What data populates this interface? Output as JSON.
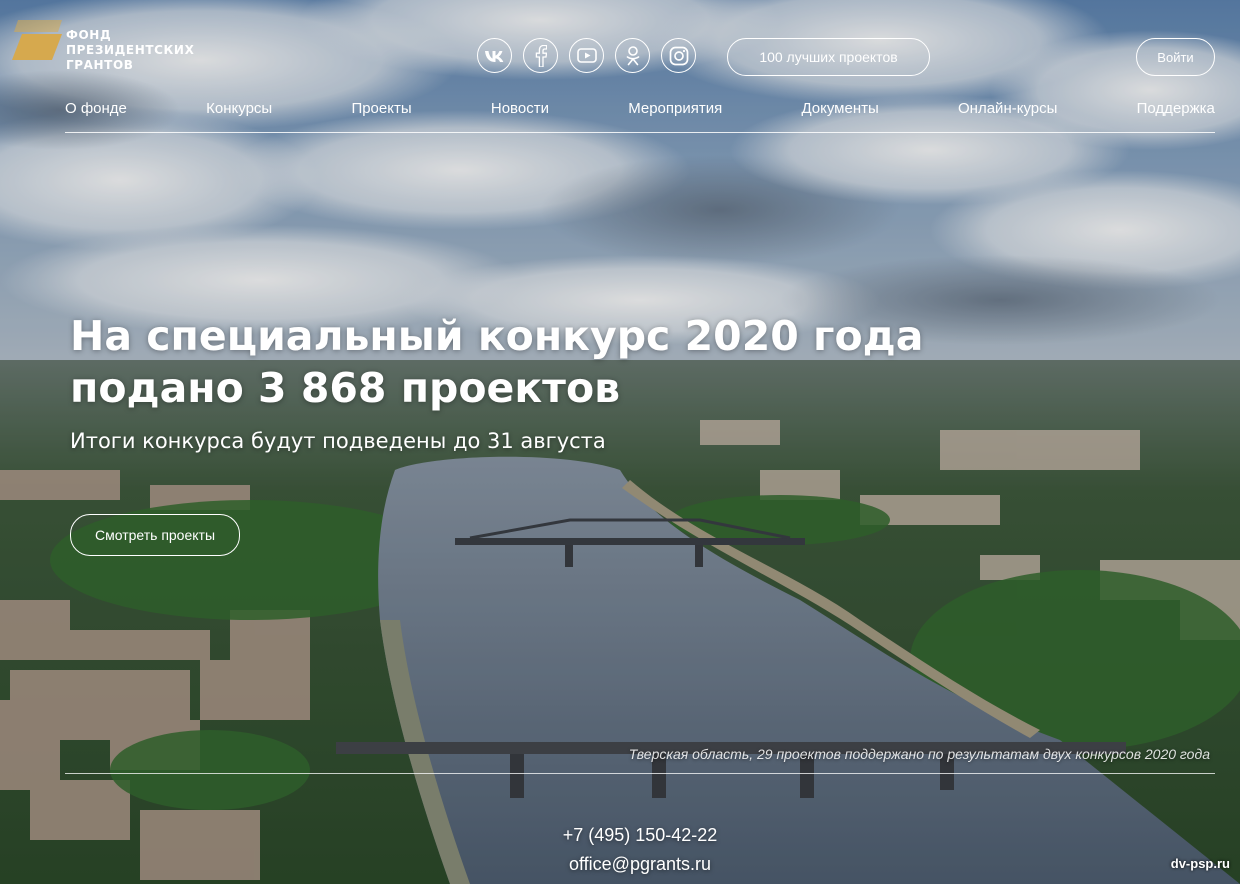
{
  "logo": {
    "line1": "ФОНД",
    "line2": "ПРЕЗИДЕНТСКИХ",
    "line3": "ГРАНТОВ"
  },
  "socials": [
    {
      "name": "vk-icon",
      "label": "vk"
    },
    {
      "name": "facebook-icon",
      "label": "f"
    },
    {
      "name": "youtube-icon"
    },
    {
      "name": "odnoklassniki-icon"
    },
    {
      "name": "instagram-icon"
    }
  ],
  "header": {
    "best_projects": "100 лучших проектов",
    "login": "Войти"
  },
  "nav": {
    "items": [
      "О фонде",
      "Конкурсы",
      "Проекты",
      "Новости",
      "Мероприятия",
      "Документы",
      "Онлайн-курсы",
      "Поддержка"
    ]
  },
  "hero": {
    "title_line1": "На специальный конкурс 2020 года",
    "title_line2": "подано 3 868 проектов",
    "subtitle": "Итоги конкурса будут подведены до 31 августа",
    "cta": "Смотреть проекты"
  },
  "caption": "Тверская область, 29 проектов поддержано по результатам двух конкурсов 2020 года",
  "contacts": {
    "phone": "+7 (495) 150-42-22",
    "email": "office@pgrants.ru"
  },
  "watermark": "dv-psp.ru",
  "colors": {
    "logo_gold": "#d6a94e",
    "sky_top": "#5f86b3",
    "river": "#5e6e80",
    "greenery": "#2f5a2c"
  }
}
